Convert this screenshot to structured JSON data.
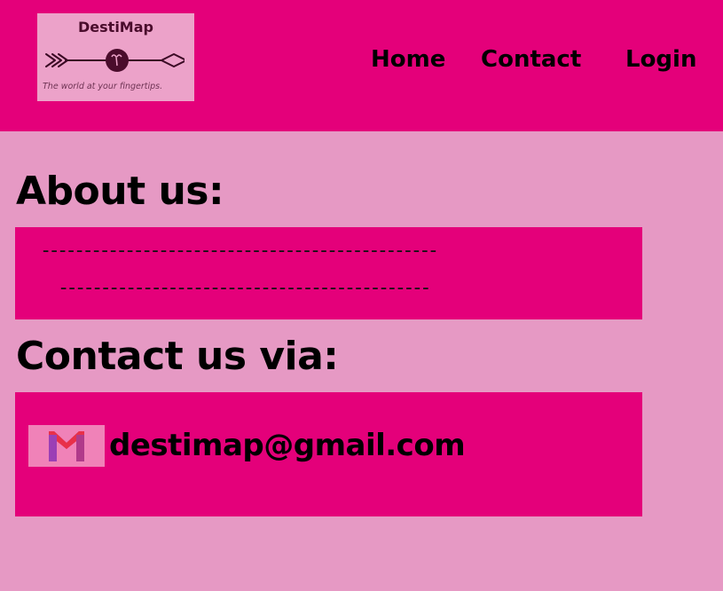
{
  "header": {
    "logo": {
      "name": "DestiMap",
      "tagline": "The world at your fingertips.",
      "icon": "arrow-logo-icon"
    },
    "nav": [
      {
        "label": "Home"
      },
      {
        "label": "Contact"
      },
      {
        "label": "Login"
      }
    ]
  },
  "about": {
    "title": "About us:",
    "lines": [
      "-----------------------------------------------",
      "--------------------------------------------"
    ]
  },
  "contact": {
    "title": "Contact us via:",
    "email": "destimap@gmail.com",
    "icon": "gmail-icon"
  },
  "colors": {
    "header_bg": "#e4007a",
    "page_bg": "#e699c4",
    "panel_bg": "#e4007a",
    "logo_bg": "#eca2c9",
    "text": "#000000"
  }
}
